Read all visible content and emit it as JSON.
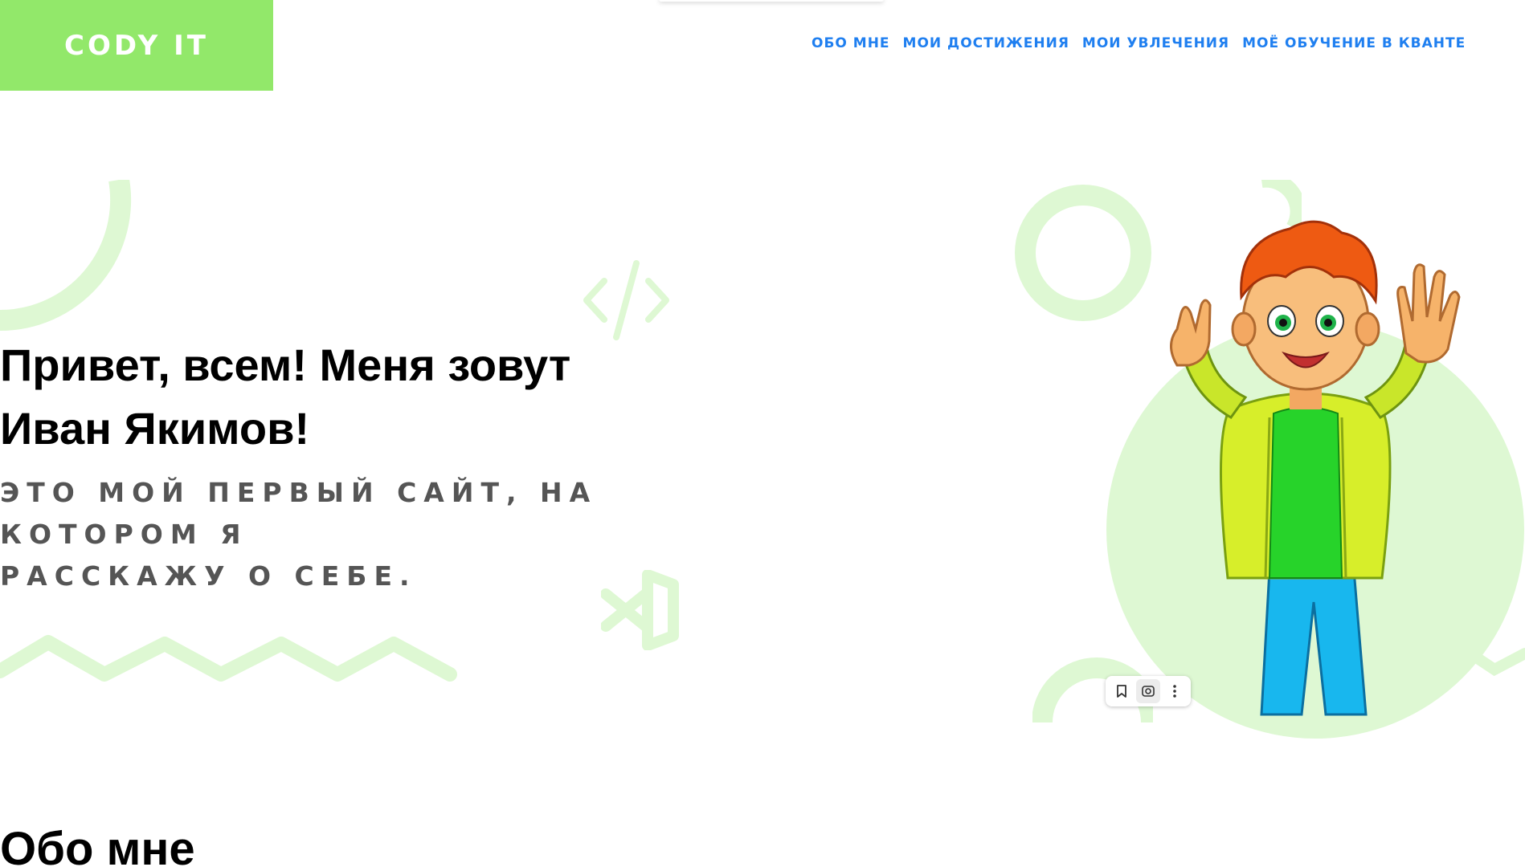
{
  "header": {
    "logo": "CODY IT",
    "nav": [
      {
        "label": "ОБО МНЕ"
      },
      {
        "label": "МОИ ДОСТИЖЕНИЯ"
      },
      {
        "label": "МОИ УВЛЕЧЕНИЯ"
      },
      {
        "label": "МОЁ ОБУЧЕНИЕ В КВАНТЕ"
      }
    ]
  },
  "hero": {
    "title_line1": "Привет, всем! Меня зовут",
    "title_line2": "Иван Якимов!",
    "subtitle_line1": "это мой первый сайт, на котором я",
    "subtitle_line2": "расскажу о себе."
  },
  "sections": {
    "about_title": "Обо мне"
  },
  "image_toolbar": {
    "buttons": [
      "bookmark-icon",
      "lens-search-icon",
      "more-vertical-icon"
    ]
  },
  "colors": {
    "brand_green": "#92e86a",
    "decor_green": "#def8d3",
    "nav_blue": "#1f7ff0",
    "subtitle_gray": "#555555"
  }
}
